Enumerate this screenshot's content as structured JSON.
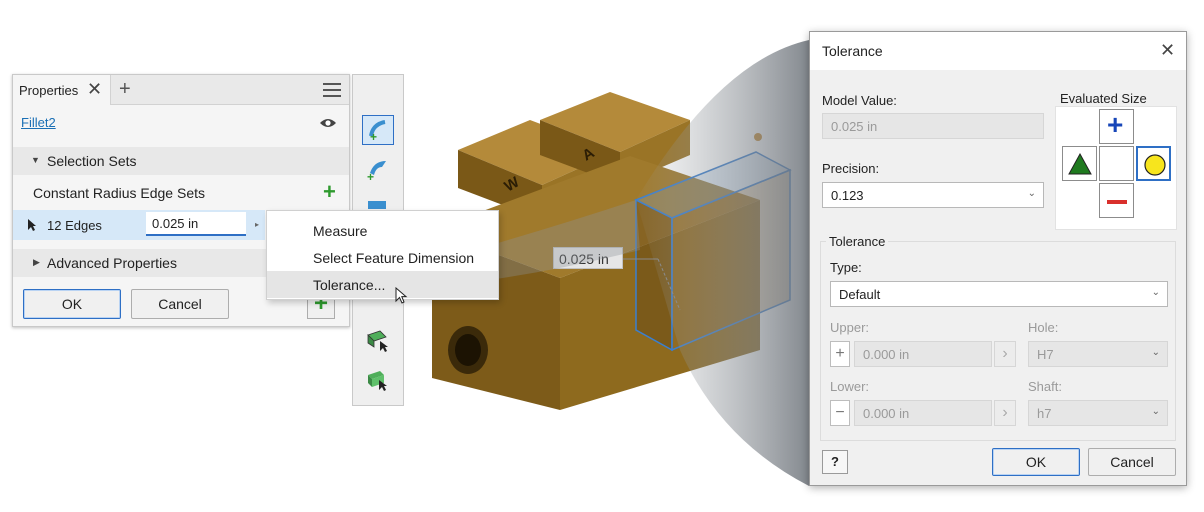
{
  "properties": {
    "tab_label": "Properties",
    "tab_close": "✕",
    "tab_add": "+",
    "feature_name": "Fillet2",
    "selection_sets_label": "Selection Sets",
    "edge_sets_label": "Constant Radius Edge Sets",
    "edge_count": "12 Edges",
    "edge_value": "0.025 in",
    "advanced_label": "Advanced Properties",
    "ok_label": "OK",
    "cancel_label": "Cancel"
  },
  "context_menu": {
    "items": [
      "Measure",
      "Select Feature Dimension",
      "Tolerance..."
    ],
    "highlighted": "Tolerance..."
  },
  "model": {
    "face_letters": [
      "W",
      "A"
    ],
    "dimension_label": "0.025 in",
    "body_color": "#8e6a1e"
  },
  "tolerance_dialog": {
    "title": "Tolerance",
    "close": "✕",
    "model_value_label": "Model Value:",
    "model_value": "0.025 in",
    "precision_label": "Precision:",
    "precision_value": "0.123",
    "evaluated_size_label": "Evaluated Size",
    "evaluated_selected": "nominal",
    "tolerance_group_label": "Tolerance",
    "type_label": "Type:",
    "type_value": "Default",
    "upper_label": "Upper:",
    "upper_value": "0.000 in",
    "lower_label": "Lower:",
    "lower_value": "0.000 in",
    "hole_label": "Hole:",
    "hole_value": "H7",
    "shaft_label": "Shaft:",
    "shaft_value": "h7",
    "stepper_arrow": "›",
    "ok_label": "OK",
    "cancel_label": "Cancel",
    "help_icon": "?"
  },
  "colors": {
    "accent": "#2e6fc5",
    "link": "#1a6fb5",
    "add_green": "#2e9a2e",
    "minus_red": "#d9302c",
    "plus_blue": "#1746b8",
    "triangle_green": "#1f7a1f",
    "circle_yellow": "#f7e51d"
  }
}
